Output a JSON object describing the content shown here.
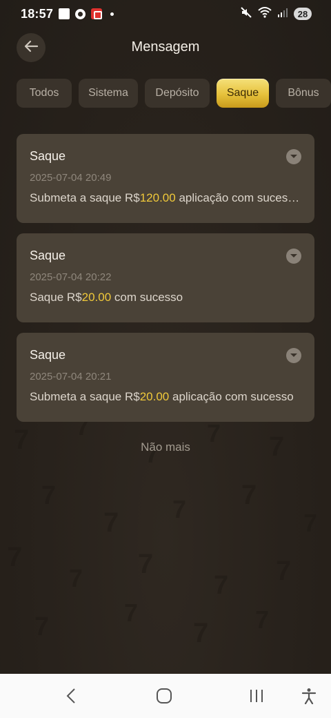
{
  "status_bar": {
    "time": "18:57",
    "battery": "28",
    "icons": [
      "notification-square-icon",
      "chrome-icon",
      "app-icon",
      "dot-icon",
      "mute-icon",
      "wifi-icon",
      "signal-icon",
      "battery-icon"
    ]
  },
  "header": {
    "title": "Mensagem",
    "back_icon": "arrow-left-icon"
  },
  "tabs": [
    {
      "label": "Todos",
      "active": false
    },
    {
      "label": "Sistema",
      "active": false
    },
    {
      "label": "Depósito",
      "active": false
    },
    {
      "label": "Saque",
      "active": true
    },
    {
      "label": "Bônus",
      "active": false
    }
  ],
  "messages": [
    {
      "title": "Saque",
      "date": "2025-07-04 20:49",
      "body_prefix": "Submeta a saque R$",
      "amount": "120.00",
      "body_suffix": " aplicação com sucesso"
    },
    {
      "title": "Saque",
      "date": "2025-07-04 20:22",
      "body_prefix": "Saque R$",
      "amount": "20.00",
      "body_suffix": " com sucesso"
    },
    {
      "title": "Saque",
      "date": "2025-07-04 20:21",
      "body_prefix": "Submeta a saque R$",
      "amount": "20.00",
      "body_suffix": " aplicação com sucesso"
    }
  ],
  "footer_text": "Não mais",
  "nav_bar": {
    "icons": [
      "back-nav-icon",
      "home-nav-icon",
      "recents-nav-icon",
      "accessibility-icon"
    ]
  },
  "colors": {
    "accent_gold": "#f0c93a",
    "card_bg": "#4a4237",
    "page_bg": "#27211b"
  }
}
